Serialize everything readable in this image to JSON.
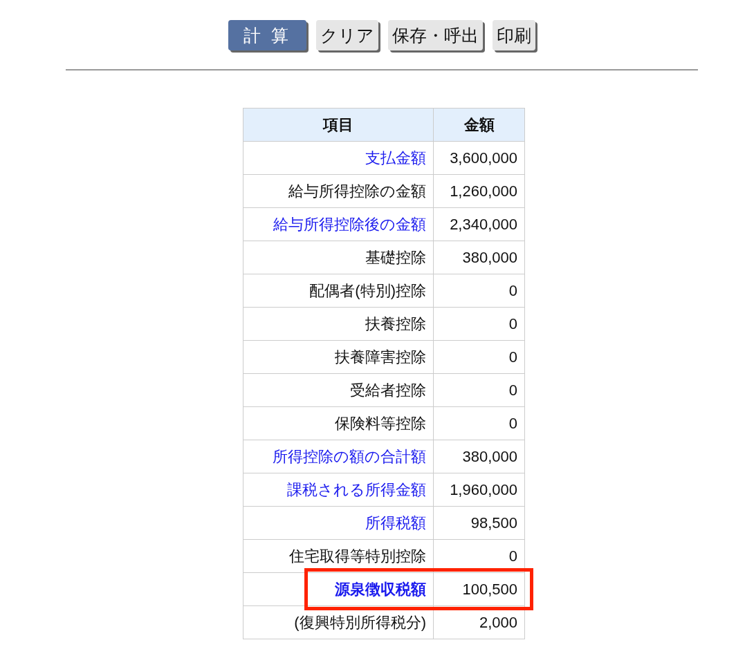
{
  "buttons": [
    {
      "label": "計 算",
      "kind": "primary"
    },
    {
      "label": "クリア",
      "kind": "secondary"
    },
    {
      "label": "保存・呼出",
      "kind": "secondary"
    },
    {
      "label": "印刷",
      "kind": "secondary"
    }
  ],
  "table": {
    "columns": [
      "項目",
      "金額"
    ],
    "rows": [
      {
        "item": "支払金額",
        "amount": "3,600,000",
        "kind": "link",
        "highlighted": false
      },
      {
        "item": "給与所得控除の金額",
        "amount": "1,260,000",
        "kind": "plain",
        "highlighted": false
      },
      {
        "item": "給与所得控除後の金額",
        "amount": "2,340,000",
        "kind": "link",
        "highlighted": false
      },
      {
        "item": "基礎控除",
        "amount": "380,000",
        "kind": "plain",
        "highlighted": false
      },
      {
        "item": "配偶者(特別)控除",
        "amount": "0",
        "kind": "plain",
        "highlighted": false
      },
      {
        "item": "扶養控除",
        "amount": "0",
        "kind": "plain",
        "highlighted": false
      },
      {
        "item": "扶養障害控除",
        "amount": "0",
        "kind": "plain",
        "highlighted": false
      },
      {
        "item": "受給者控除",
        "amount": "0",
        "kind": "plain",
        "highlighted": false
      },
      {
        "item": "保険料等控除",
        "amount": "0",
        "kind": "plain",
        "highlighted": false
      },
      {
        "item": "所得控除の額の合計額",
        "amount": "380,000",
        "kind": "link",
        "highlighted": false
      },
      {
        "item": "課税される所得金額",
        "amount": "1,960,000",
        "kind": "link",
        "highlighted": false
      },
      {
        "item": "所得税額",
        "amount": "98,500",
        "kind": "link",
        "highlighted": false
      },
      {
        "item": "住宅取得等特別控除",
        "amount": "0",
        "kind": "plain",
        "highlighted": false
      },
      {
        "item": "源泉徴収税額",
        "amount": "100,500",
        "kind": "total",
        "highlighted": true
      },
      {
        "item": "(復興特別所得税分)",
        "amount": "2,000",
        "kind": "plain",
        "highlighted": false
      }
    ]
  }
}
